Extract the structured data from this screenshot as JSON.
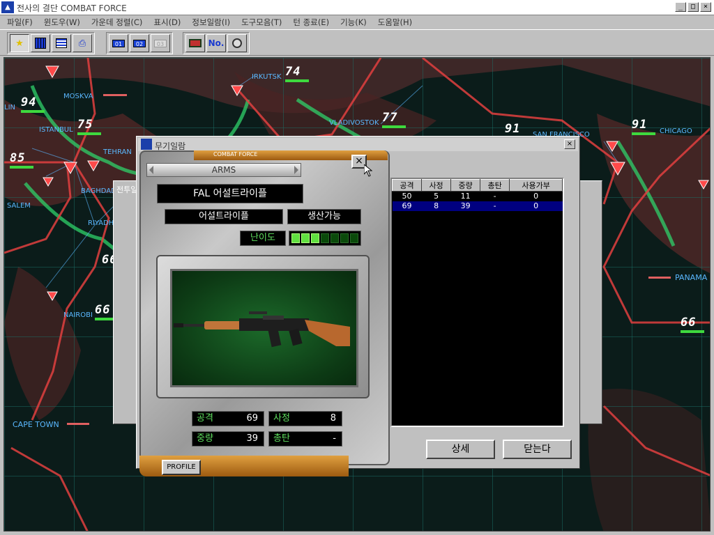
{
  "window": {
    "title": "전사의 결단 COMBAT FORCE",
    "icon": "app-logo-icon"
  },
  "menu": [
    "파일(F)",
    "윈도우(W)",
    "가운데 정렬(C)",
    "표시(D)",
    "정보일람(I)",
    "도구모음(T)",
    "턴 종료(E)",
    "기능(K)",
    "도움말(H)"
  ],
  "toolbar": {
    "chip1": "01",
    "chip2": "02",
    "chip3": "03",
    "no_label": "No."
  },
  "map": {
    "cities": [
      "MOSKVA",
      "IRKUTSK",
      "VLADIVOSTOK",
      "ISTANBUL",
      "TEHRAN",
      "BAGHDAD",
      "SALEM",
      "RIYADH",
      "NAIROBI",
      "CAPE TOWN",
      "SAN FRANCISCO",
      "CHICAGO",
      "PANAMA",
      "LIN"
    ],
    "numbers": [
      "94",
      "74",
      "77",
      "75",
      "85",
      "91",
      "91",
      "66",
      "66",
      "66"
    ]
  },
  "bgwin": {
    "title": "전투일"
  },
  "wlist": {
    "title": "무기일람",
    "columns": [
      "공격",
      "사정",
      "중량",
      "총탄",
      "사용가부"
    ],
    "rows": [
      [
        "50",
        "5",
        "11",
        "-",
        "0"
      ],
      [
        "69",
        "8",
        "39",
        "-",
        "0"
      ]
    ],
    "detail_btn": "상세",
    "close_btn": "닫는다"
  },
  "detail": {
    "brand": "COMBAT FORCE",
    "category": "ARMS",
    "name": "FAL 어설트라이플",
    "class": "어설트라이플",
    "production": "생산가능",
    "difficulty_label": "난이도",
    "difficulty_level": 3,
    "difficulty_max": 7,
    "stats": {
      "attack_label": "공격",
      "attack": "69",
      "range_label": "사정",
      "range": "8",
      "weight_label": "중량",
      "weight": "39",
      "ammo_label": "총탄",
      "ammo": "-"
    },
    "profile_btn": "PROFILE"
  }
}
